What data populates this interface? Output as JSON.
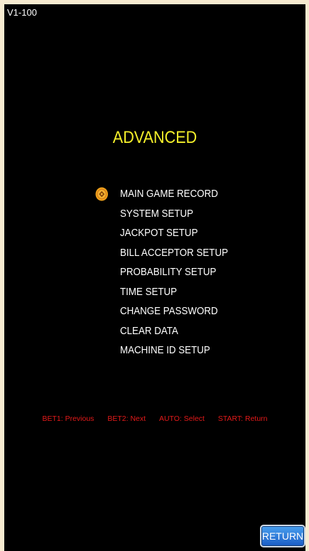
{
  "version": "V1-100",
  "title": "ADVANCED",
  "menu": {
    "selected_index": 0,
    "items": [
      {
        "label": "MAIN GAME RECORD"
      },
      {
        "label": "SYSTEM SETUP"
      },
      {
        "label": "JACKPOT SETUP"
      },
      {
        "label": "BILL ACCEPTOR SETUP"
      },
      {
        "label": "PROBABILITY SETUP"
      },
      {
        "label": "TIME SETUP"
      },
      {
        "label": "CHANGE PASSWORD"
      },
      {
        "label": "CLEAR DATA"
      },
      {
        "label": "MACHINE ID SETUP"
      }
    ]
  },
  "hints": {
    "bet1": "BET1: Previous",
    "bet2": "BET2: Next",
    "auto": "AUTO: Select",
    "start": "START: Return"
  },
  "return_button": {
    "label": "RETURN"
  },
  "colors": {
    "background": "#000000",
    "title": "#f4ef2a",
    "menu_text": "#ffffff",
    "hint_text": "#e41a1a",
    "cursor": "#f0a21a",
    "button": "#2a78dc"
  },
  "icons": {
    "cursor": "coin-cursor-icon"
  }
}
